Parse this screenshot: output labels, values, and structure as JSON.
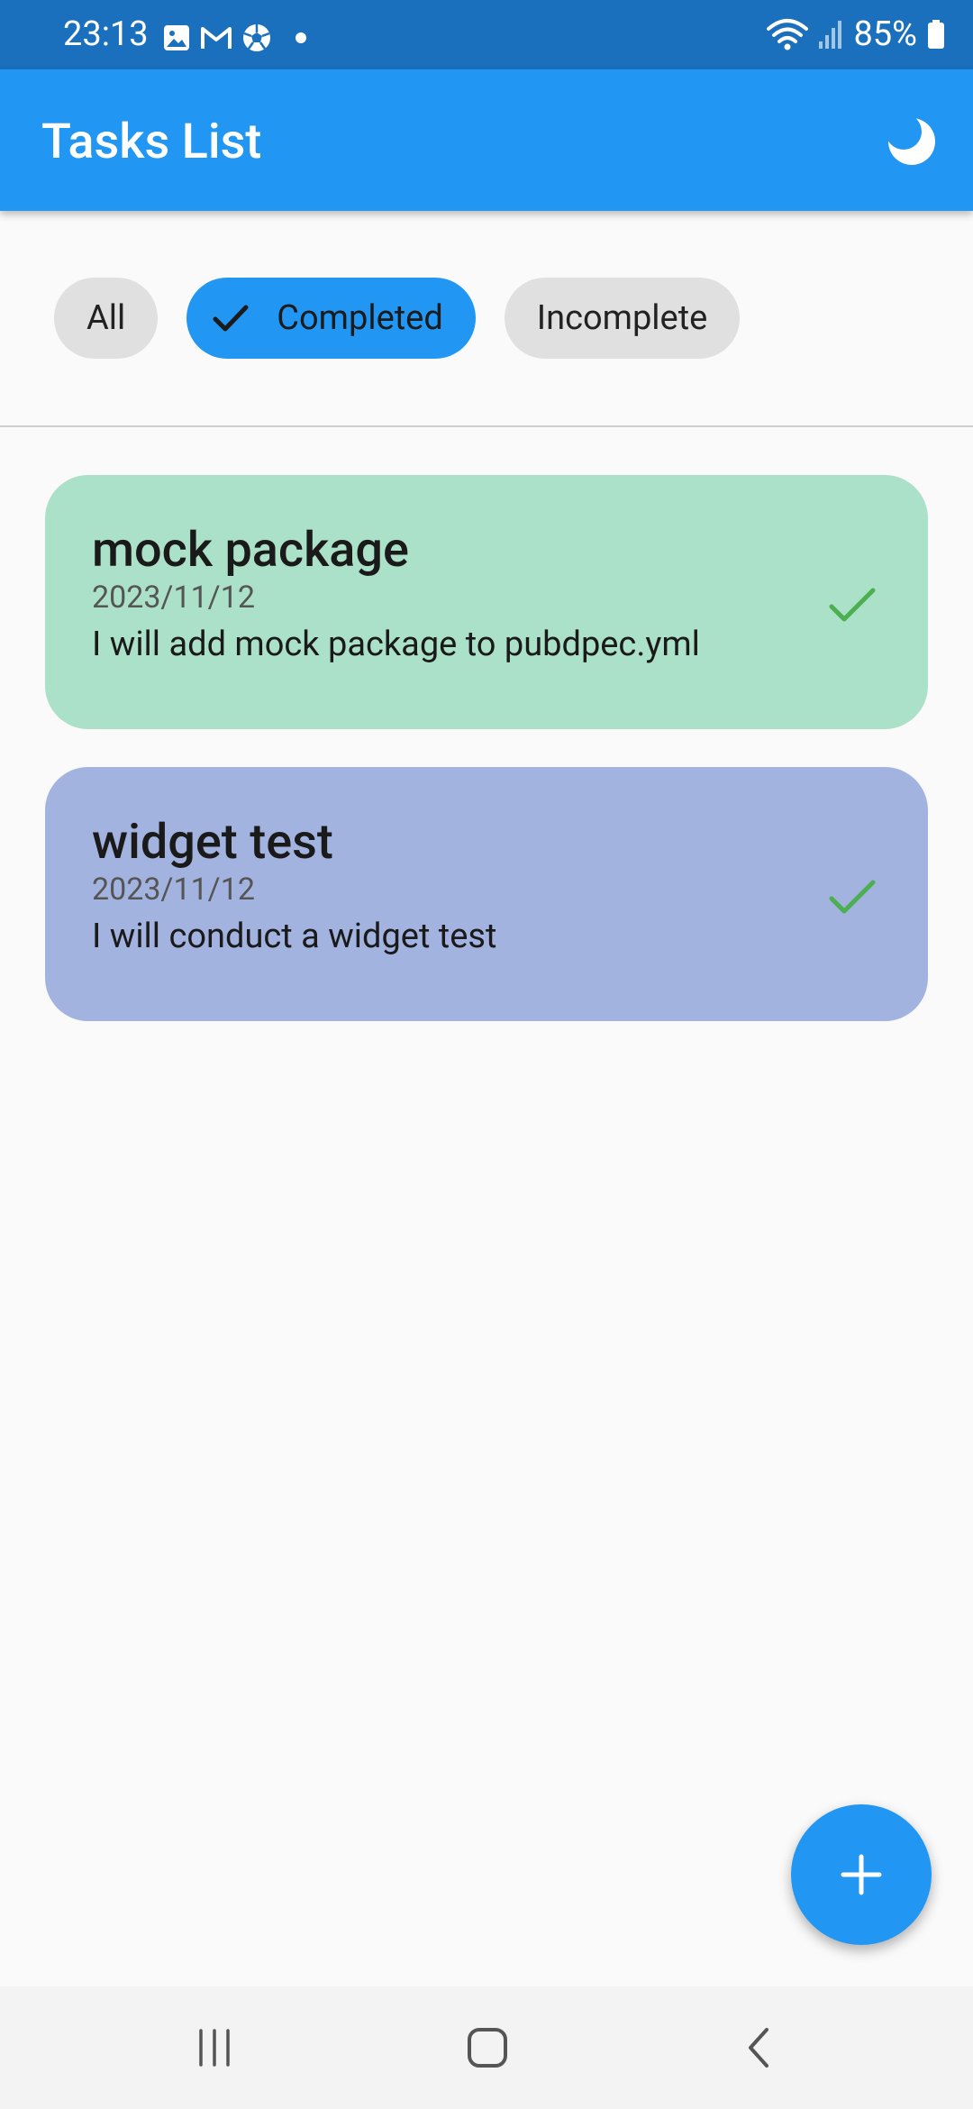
{
  "status_bar": {
    "time": "23:13",
    "notification_icons": [
      "gallery-icon",
      "gmail-icon",
      "soccer-ball-icon",
      "dot-icon"
    ],
    "right_icons": [
      "wifi-icon",
      "signal-icon",
      "battery-icon"
    ],
    "battery": "85%"
  },
  "app_bar": {
    "title": "Tasks List",
    "theme_icon": "moon-icon"
  },
  "filters": {
    "chips": [
      {
        "label": "All",
        "selected": false
      },
      {
        "label": "Completed",
        "selected": true
      },
      {
        "label": "Incomplete",
        "selected": false
      }
    ]
  },
  "tasks": [
    {
      "title": "mock package",
      "date": "2023/11/12",
      "description": "I will add mock package to pubdpec.yml",
      "completed": true,
      "color": "#abe1c8"
    },
    {
      "title": "widget test",
      "date": "2023/11/12",
      "description": "I will conduct a widget test",
      "completed": true,
      "color": "#a3b3e0"
    }
  ],
  "fab": {
    "icon": "plus-icon"
  },
  "nav_bar": {
    "buttons": [
      "recent-apps-icon",
      "home-icon",
      "back-icon"
    ]
  },
  "colors": {
    "primary": "#2196f3",
    "status_bar": "#1a70bd",
    "check": "#4caf50"
  }
}
